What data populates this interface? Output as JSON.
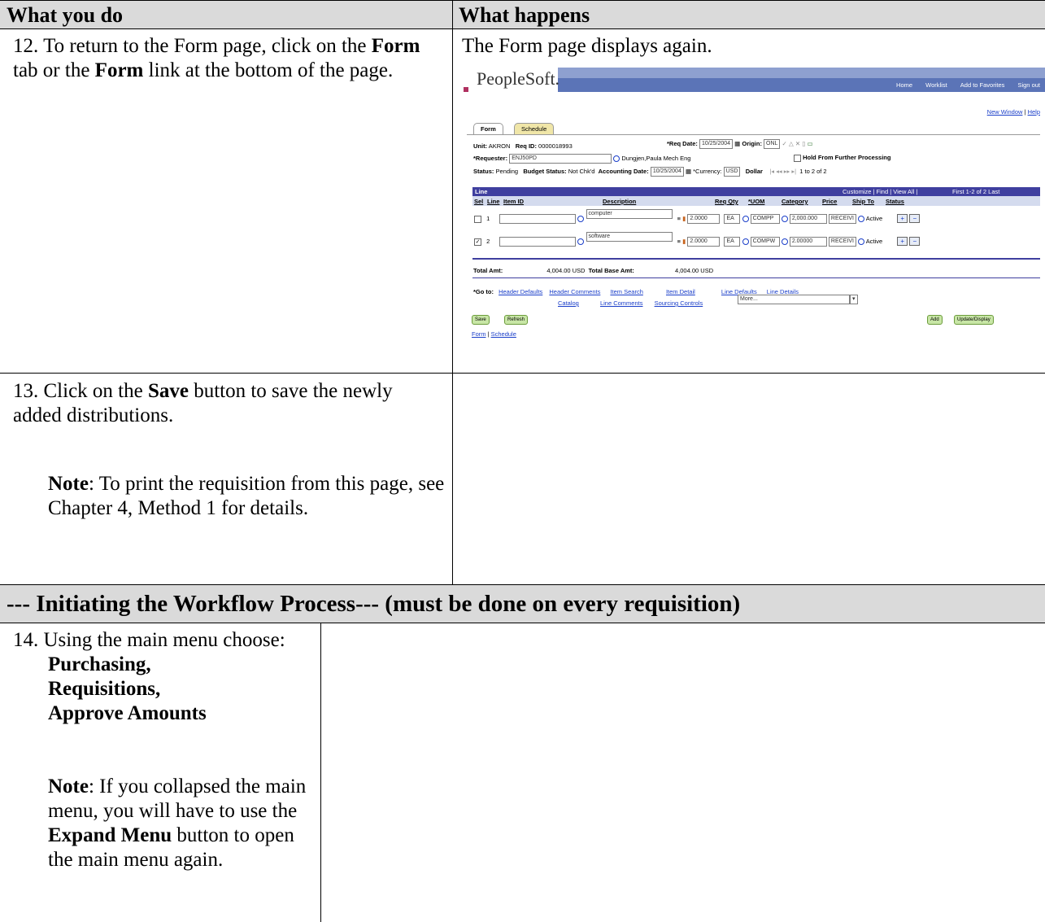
{
  "table": {
    "headers": [
      "What you do",
      "What happens"
    ]
  },
  "step12": {
    "number": "12.",
    "text_before_1": "To return to the Form page, click on the ",
    "bold_1": "Form",
    "text_mid": " tab or the ",
    "bold_2": "Form",
    "text_after": " link at the bottom of the page.",
    "result": "The Form page displays again."
  },
  "step13": {
    "number": "13.",
    "text_before": "Click on the ",
    "bold": "Save",
    "text_after": " button to save the newly added distributions.",
    "note_label": "Note",
    "note_text": ":  To print the requisition from this page, see Chapter 4, Method 1 for details."
  },
  "section": {
    "title": "--- Initiating the Workflow Process--- (must be done on every requisition)"
  },
  "step14": {
    "number": "14.",
    "text": "Using the main menu choose:",
    "menu_path": [
      "Purchasing,",
      "Requisitions,",
      "Approve Amounts"
    ],
    "note_label": "Note",
    "note_text_1": ":  If you collapsed the main menu, you will have to use the ",
    "note_bold": "Expand Menu",
    "note_text_2": " button to open the main menu again."
  },
  "screenshot": {
    "logo": "PeopleSoft.",
    "top_nav": [
      "Home",
      "Worklist",
      "Add to Favorites",
      "Sign out"
    ],
    "new_window": "New Window",
    "help": "Help",
    "tabs": [
      "Form",
      "Schedule"
    ],
    "unit_label": "Unit:",
    "unit_value": "AKRON",
    "reqid_label": "Req ID:",
    "reqid_value": "0000018993",
    "reqdate_label": "*Req Date:",
    "reqdate_value": "10/25/2004",
    "origin_label": "Origin:",
    "origin_value": "ONL",
    "requester_label": "*Requester:",
    "requester_value": "ENJ50PD",
    "requester_name": "Dungjen,Paula Mech Eng",
    "hold_label": "Hold From Further Processing",
    "status_label": "Status:",
    "status_value": "Pending",
    "budget_label": "Budget Status:",
    "budget_value": "Not Chk'd",
    "acctdate_label": "Accounting Date:",
    "acctdate_value": "10/25/2004",
    "currency_label": "*Currency:",
    "currency_value": "USD",
    "currency_name": "Dollar",
    "paging": "1 to 2 of 2",
    "grid_title": "Line",
    "grid_links": "Customize | Find | View All |",
    "grid_paging": "First  1-2 of 2  Last",
    "columns": [
      "Sel",
      "Line",
      "Item ID",
      "Description",
      "Req Qty",
      "*UOM",
      "Category",
      "Price",
      "Ship To",
      "Status"
    ],
    "rows": [
      {
        "line": "1",
        "description": "computer",
        "qty": "2.0000",
        "uom": "EA",
        "category": "COMPP",
        "price": "2,000.000",
        "ship_to": "RECEIVI",
        "status": "Active"
      },
      {
        "line": "2",
        "description": "software",
        "qty": "2.0000",
        "uom": "EA",
        "category": "COMPW",
        "price": "2.00000",
        "ship_to": "RECEIVI",
        "status": "Active"
      }
    ],
    "total_label": "Total Amt:",
    "total_value": "4,004.00  USD",
    "total_base_label": "Total Base Amt:",
    "total_base_value": "4,004.00  USD",
    "goto_label": "*Go to:",
    "goto_links_row1": [
      "Header Defaults",
      "Header Comments",
      "Item Search",
      "Item Detail",
      "Line Defaults",
      "Line Details"
    ],
    "goto_links_row2": [
      "Catalog",
      "Line Comments",
      "Sourcing Controls"
    ],
    "more": "More...",
    "save_btn": "Save",
    "refresh_btn": "Refresh",
    "add_btn": "Add",
    "update_btn": "Update/Display",
    "bottom_links": [
      "Form",
      "Schedule"
    ]
  }
}
